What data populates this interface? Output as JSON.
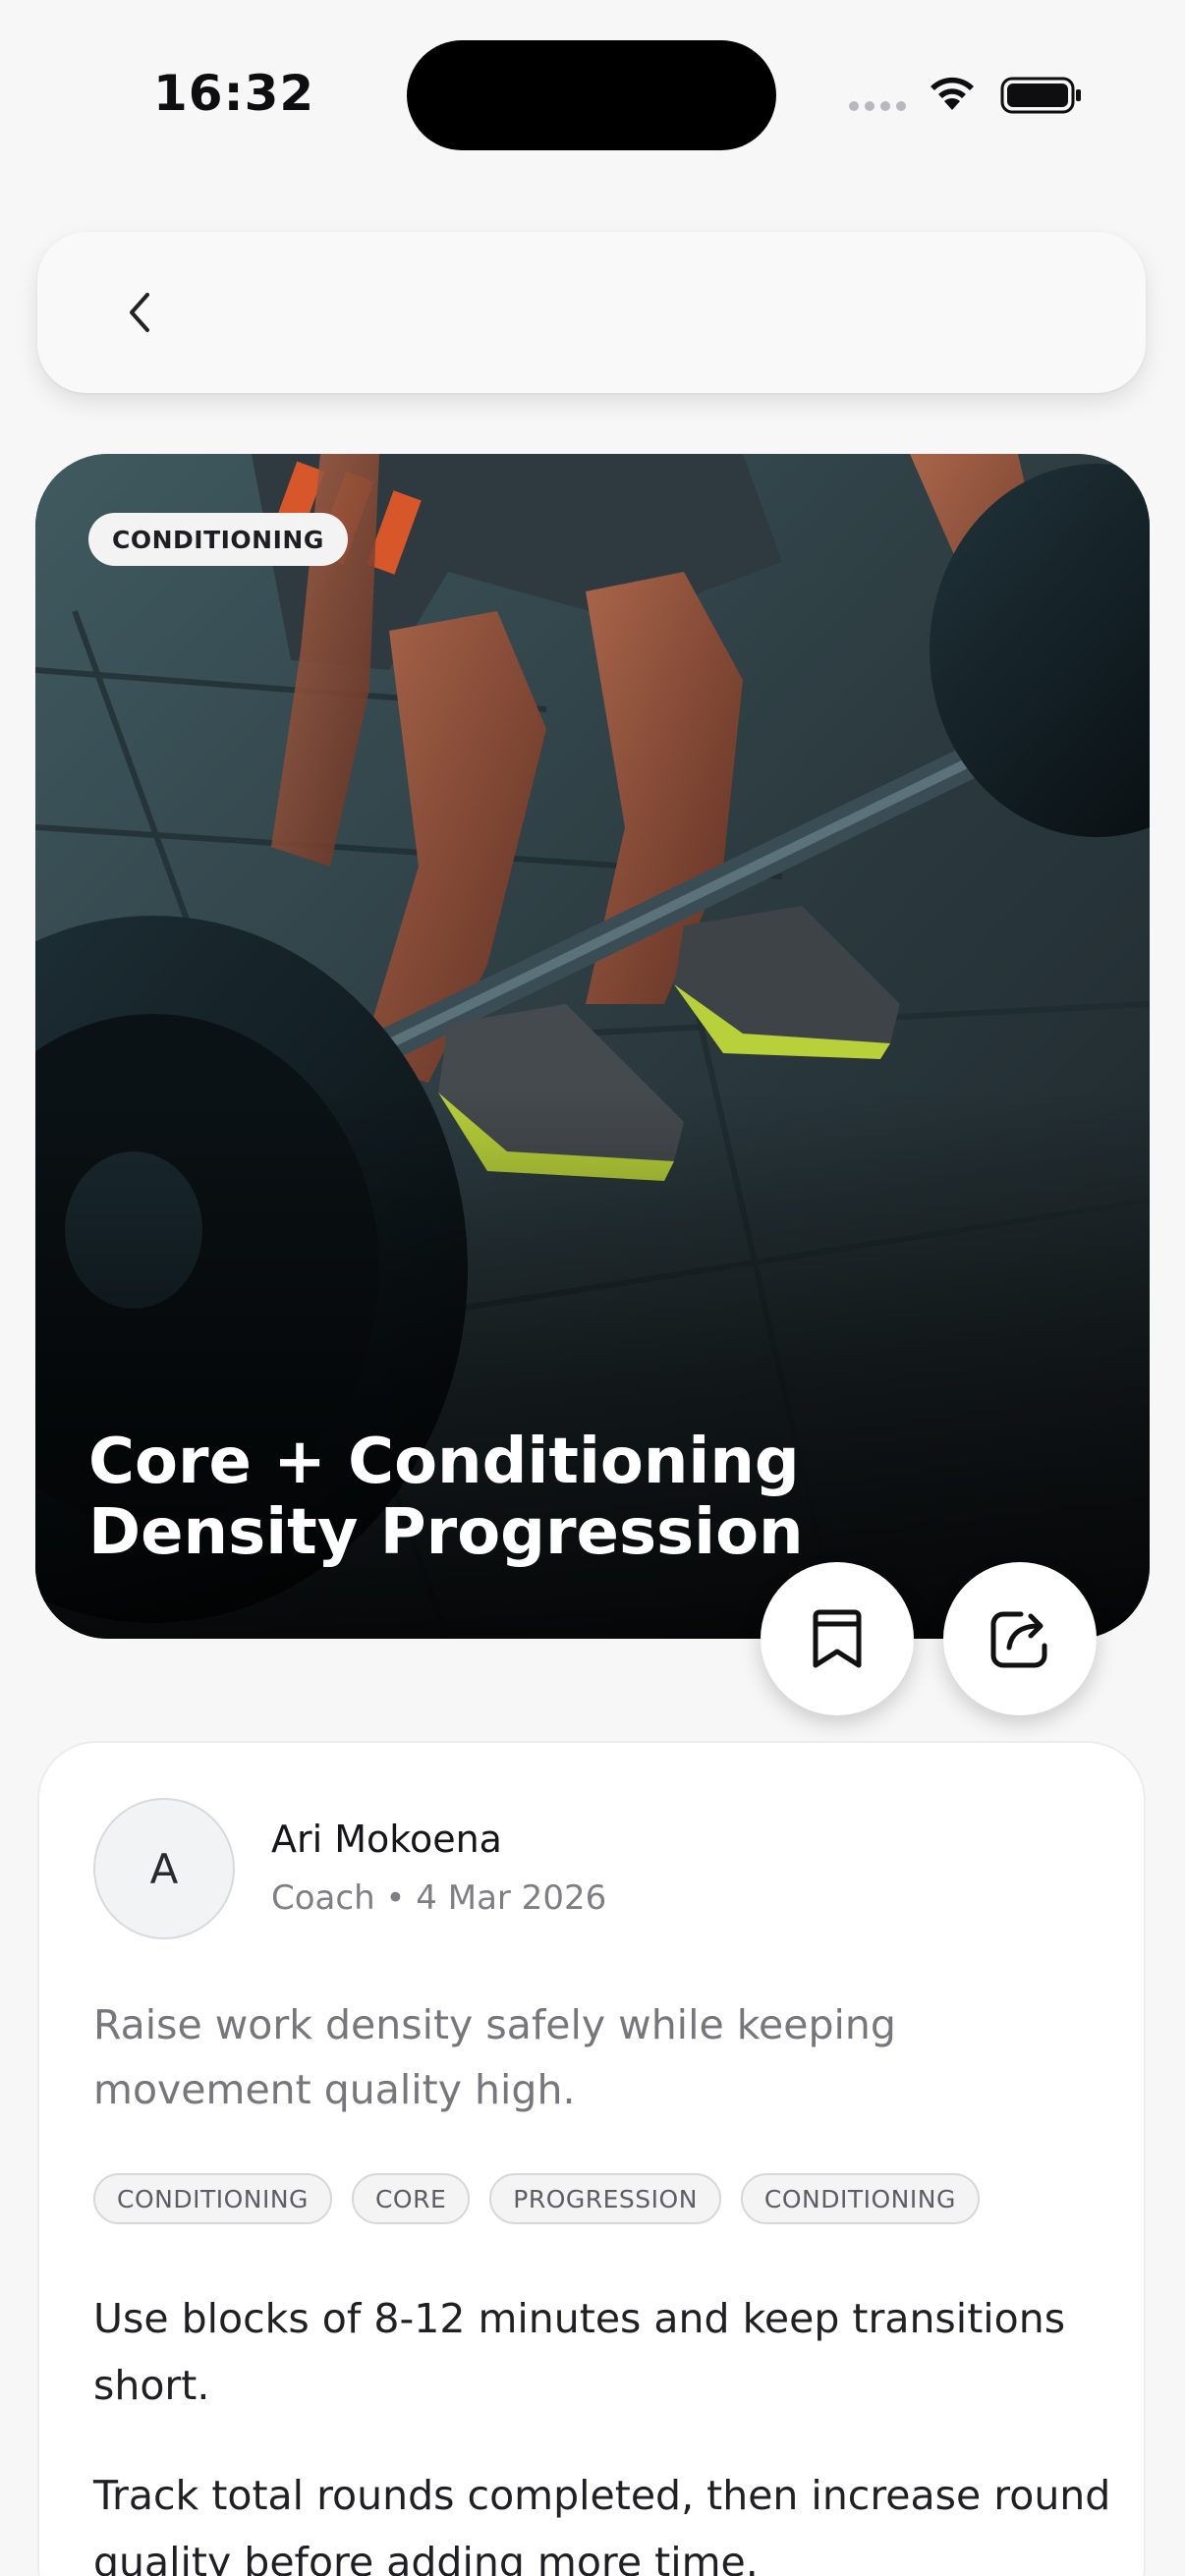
{
  "status_bar": {
    "time": "16:32",
    "icons": [
      "cellular-signal-icon",
      "wifi-icon",
      "battery-icon"
    ]
  },
  "nav": {
    "back_icon": "chevron-left-icon"
  },
  "hero": {
    "badge": "CONDITIONING",
    "title": "Core + Conditioning Density Progression",
    "image": "athlete-deadlift-barbell-photo"
  },
  "actions": {
    "save_icon": "bookmark-icon",
    "share_icon": "share-icon"
  },
  "author": {
    "initial": "A",
    "name": "Ari Mokoena",
    "meta": "Coach • 4 Mar 2026"
  },
  "summary": "Raise work density safely while keeping movement quality high.",
  "tags": [
    "CONDITIONING",
    "CORE",
    "PROGRESSION",
    "CONDITIONING"
  ],
  "body": [
    "Use blocks of 8-12 minutes and keep transitions short.",
    "Track total rounds completed, then increase round quality before adding more time."
  ],
  "colors": {
    "background": "#f7f7f7",
    "card": "#ffffff",
    "text_primary": "#1b1b1f",
    "text_secondary": "#76767c"
  }
}
